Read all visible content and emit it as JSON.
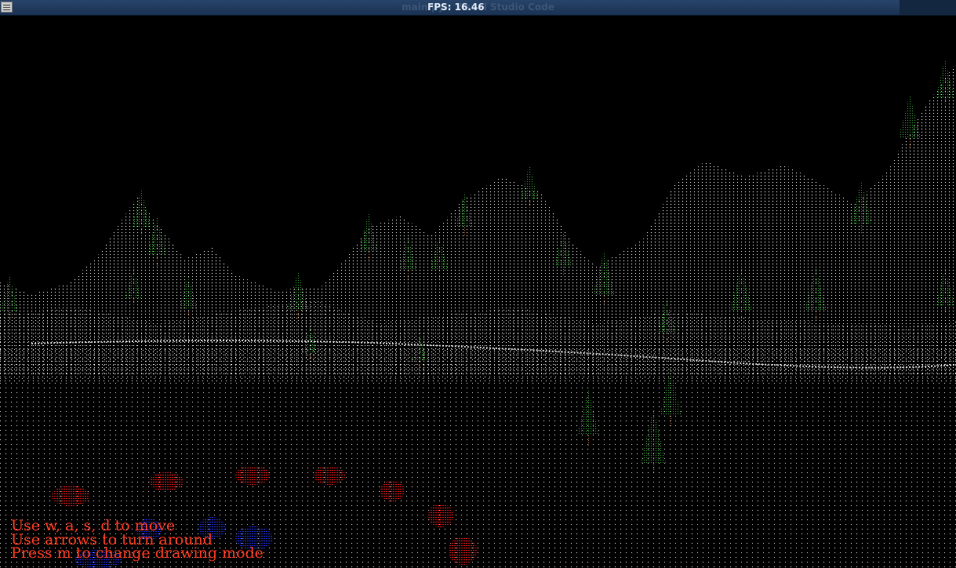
{
  "window": {
    "title": "main.py - Visual Studio Code",
    "fps_label": "FPS:",
    "fps_value": "16.46"
  },
  "hud": {
    "line1": "Use w, a, s, d to move",
    "line2": "Use arrows to turn around",
    "line3": "Press m to change drawing mode"
  },
  "colors": {
    "background": "#000000",
    "terrain_points": "#ffffff",
    "tree_foliage": "#3aa83a",
    "tree_trunk": "#c07030",
    "teapot_red": "#e01818",
    "teapot_blue": "#2030e0",
    "hud_text": "#ff3c20"
  }
}
